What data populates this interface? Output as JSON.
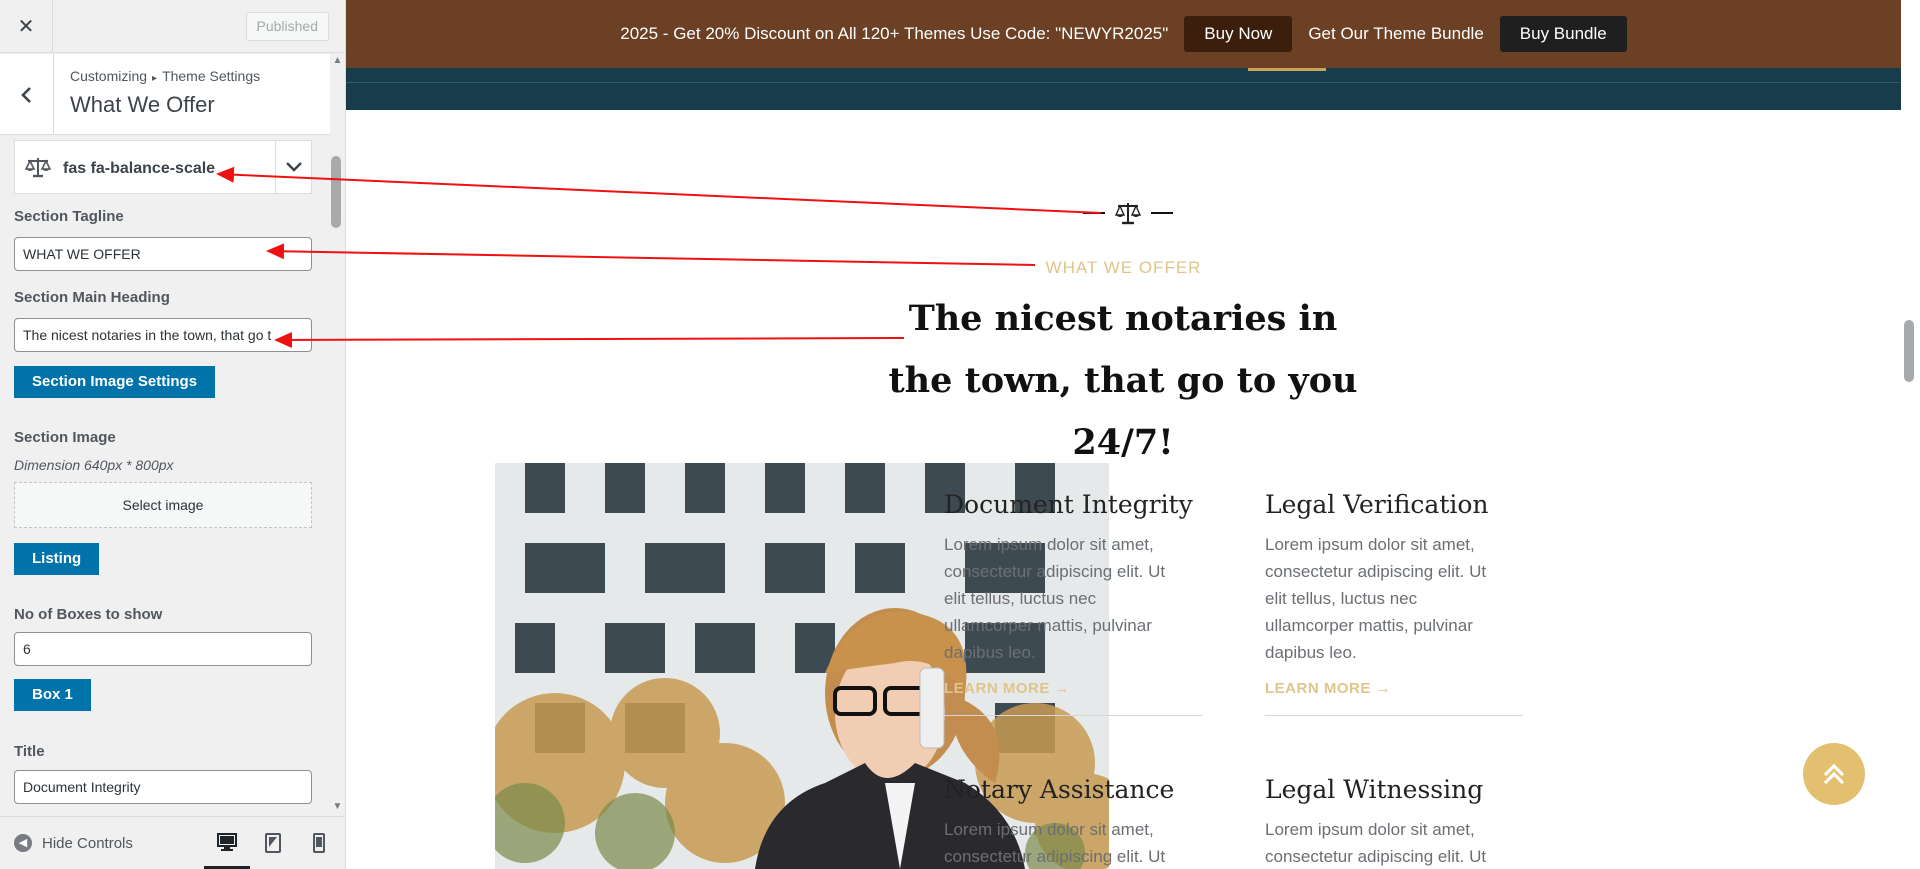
{
  "sidebar": {
    "close_icon": "close-icon",
    "published_label": "Published",
    "breadcrumb": {
      "root": "Customizing",
      "section": "Theme Settings"
    },
    "panel_title": "What We Offer",
    "icon_value": "fas fa-balance-scale",
    "fields": {
      "tagline_label": "Section Tagline",
      "tagline_value": "WHAT WE OFFER",
      "heading_label": "Section Main Heading",
      "heading_value": "The nicest notaries in the town, that go t",
      "image_settings_button": "Section Image Settings",
      "image_label": "Section Image",
      "image_dimension": "Dimension 640px * 800px",
      "select_image": "Select image",
      "listing_button": "Listing",
      "boxes_label": "No of Boxes to show",
      "boxes_value": "6",
      "box1_button": "Box 1",
      "title_label": "Title",
      "title_value": "Document Integrity"
    },
    "footer": {
      "hide_controls": "Hide Controls"
    }
  },
  "preview": {
    "promo": {
      "text": "2025 - Get 20% Discount on All 120+ Themes Use Code: \"NEWYR2025\"",
      "buy_now": "Buy Now",
      "bundle_text": "Get Our Theme Bundle",
      "buy_bundle": "Buy Bundle"
    },
    "section": {
      "tagline": "WHAT WE OFFER",
      "heading": "The nicest notaries in the town, that go to you 24/7!"
    },
    "services": [
      {
        "title": "Document Integrity",
        "desc": "Lorem ipsum dolor sit amet, consectetur adipiscing elit. Ut elit tellus, luctus nec ullamcorper mattis, pulvinar dapibus leo.",
        "more": "LEARN MORE →"
      },
      {
        "title": "Legal Verification",
        "desc": "Lorem ipsum dolor sit amet, consectetur adipiscing elit. Ut elit tellus, luctus nec ullamcorper mattis, pulvinar dapibus leo.",
        "more": "LEARN MORE →"
      },
      {
        "title": "Notary Assistance",
        "desc": "Lorem ipsum dolor sit amet, consectetur adipiscing elit. Ut"
      },
      {
        "title": "Legal Witnessing",
        "desc": "Lorem ipsum dolor sit amet, consectetur adipiscing elit. Ut"
      }
    ]
  },
  "colors": {
    "customizer_blue": "#0073aa",
    "promo_brown": "#6b4024",
    "nav_teal": "#173c4c",
    "gold_accent": "#e0c48a",
    "annotation_red": "#ee1111"
  }
}
